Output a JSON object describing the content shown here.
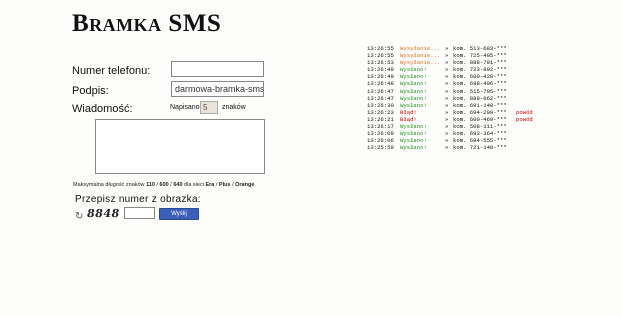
{
  "header": {
    "title": "Bramka SMS"
  },
  "form": {
    "phone_label": "Numer telefonu:",
    "phone_value": "",
    "signature_label": "Podpis:",
    "signature_value": "darmowa-bramka-sms",
    "message_label": "Wiadomość:",
    "written_prefix": "Napisano",
    "written_count": "5",
    "written_suffix": "znaków",
    "message_value": "",
    "maxlen": {
      "prefix": "Maksymalna długość znaków",
      "v1": "110",
      "sep1": " / ",
      "v2": "600",
      "sep2": " / ",
      "v3": "640",
      "mid": " dla sieci ",
      "n1": "Era",
      "n2": "Plus",
      "n3": "Orange"
    },
    "captcha_label": "Przepisz numer z obrazka:",
    "refresh_icon": "↻",
    "captcha_text": "8848",
    "captcha_value": "",
    "send_label": "Wyślij"
  },
  "log": {
    "rows": [
      {
        "time": "13:26:55",
        "status": "Wysyłanie...",
        "kind": "sending",
        "arrow": "»",
        "number": "kom. 513-683-***",
        "reason": ""
      },
      {
        "time": "13:26:55",
        "status": "Wysyłanie...",
        "kind": "sending",
        "arrow": "»",
        "number": "kom. 725-405-***",
        "reason": ""
      },
      {
        "time": "13:26:53",
        "status": "Wysyłanie...",
        "kind": "sending",
        "arrow": "»",
        "number": "kom. 888-791-***",
        "reason": ""
      },
      {
        "time": "13:26:49",
        "status": "Wysłano!",
        "kind": "sent",
        "arrow": "»",
        "number": "kom. 723-892-***",
        "reason": ""
      },
      {
        "time": "13:26:49",
        "status": "Wysłano!",
        "kind": "sent",
        "arrow": "»",
        "number": "kom. 600-428-***",
        "reason": ""
      },
      {
        "time": "13:26:48",
        "status": "Wysłano!",
        "kind": "sent",
        "arrow": "»",
        "number": "kom. 698-406-***",
        "reason": ""
      },
      {
        "time": "13:26:47",
        "status": "Wysłano!",
        "kind": "sent",
        "arrow": "»",
        "number": "kom. 515-795-***",
        "reason": ""
      },
      {
        "time": "13:26:47",
        "status": "Wysłano!",
        "kind": "sent",
        "arrow": "»",
        "number": "kom. 889-062-***",
        "reason": ""
      },
      {
        "time": "13:26:30",
        "status": "Wysłano!",
        "kind": "sent",
        "arrow": "»",
        "number": "kom. 691-140-***",
        "reason": ""
      },
      {
        "time": "13:26:23",
        "status": "Błąd!",
        "kind": "error",
        "arrow": "»",
        "number": "kom. 694-209-***",
        "reason": "powód"
      },
      {
        "time": "13:26:21",
        "status": "Błąd!",
        "kind": "error",
        "arrow": "»",
        "number": "kom. 600-469-***",
        "reason": "powód"
      },
      {
        "time": "13:26:17",
        "status": "Wysłano!",
        "kind": "sent",
        "arrow": "»",
        "number": "kom. 508-111-***",
        "reason": ""
      },
      {
        "time": "13:26:09",
        "status": "Wysłano!",
        "kind": "sent",
        "arrow": "»",
        "number": "kom. 693-364-***",
        "reason": ""
      },
      {
        "time": "13:26:06",
        "status": "Wysłano!",
        "kind": "sent",
        "arrow": "»",
        "number": "kom. 694-555-***",
        "reason": ""
      },
      {
        "time": "13:25:59",
        "status": "Wysłano!",
        "kind": "sent",
        "arrow": "»",
        "number": "kom. 721-148-***",
        "reason": ""
      }
    ]
  }
}
